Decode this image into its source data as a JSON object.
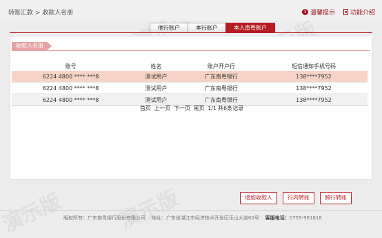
{
  "breadcrumb": "转账汇款 > 收款人名册",
  "header_actions": {
    "tips": "温馨提示",
    "intro": "功能介绍"
  },
  "tabs": [
    {
      "label": "他行账户"
    },
    {
      "label": "本行账户"
    },
    {
      "label": "本人南粤账户"
    }
  ],
  "panel": {
    "title": "收款人名册",
    "columns": [
      "账号",
      "姓名",
      "账户开户行",
      "短信通知手机号码"
    ],
    "rows": [
      {
        "account": "6224 4800 **** ***8",
        "name": "测试用户",
        "bank": "广东南粤银行",
        "phone": "138****7952"
      },
      {
        "account": "6224 4800 **** ***8",
        "name": "测试用户",
        "bank": "广东南粤银行",
        "phone": "138****7952"
      },
      {
        "account": "6224 4800 **** ***8",
        "name": "测试用户",
        "bank": "广东南粤银行",
        "phone": "138****7952"
      }
    ]
  },
  "pager": {
    "first": "首页",
    "prev": "上一页",
    "next": "下一页",
    "last": "尾页",
    "page": "1/1",
    "total": "共6条记录"
  },
  "buttons": {
    "add_payee": "增加收款人",
    "intra_bank": "行内转账",
    "inter_bank": "跨行转账"
  },
  "footer": {
    "copyright": "版权所有：广东南粤银行股份有限公司",
    "address": "地址：广东省湛江市经济技术开发区乐山大道60号",
    "hotline_label": "客服电话：",
    "hotline": "0759-961818"
  },
  "watermark_text": "演示版",
  "colors": {
    "brand": "#b71c24",
    "selected_row": "#f7d3c5",
    "panel_title": "#e4a2a2"
  }
}
